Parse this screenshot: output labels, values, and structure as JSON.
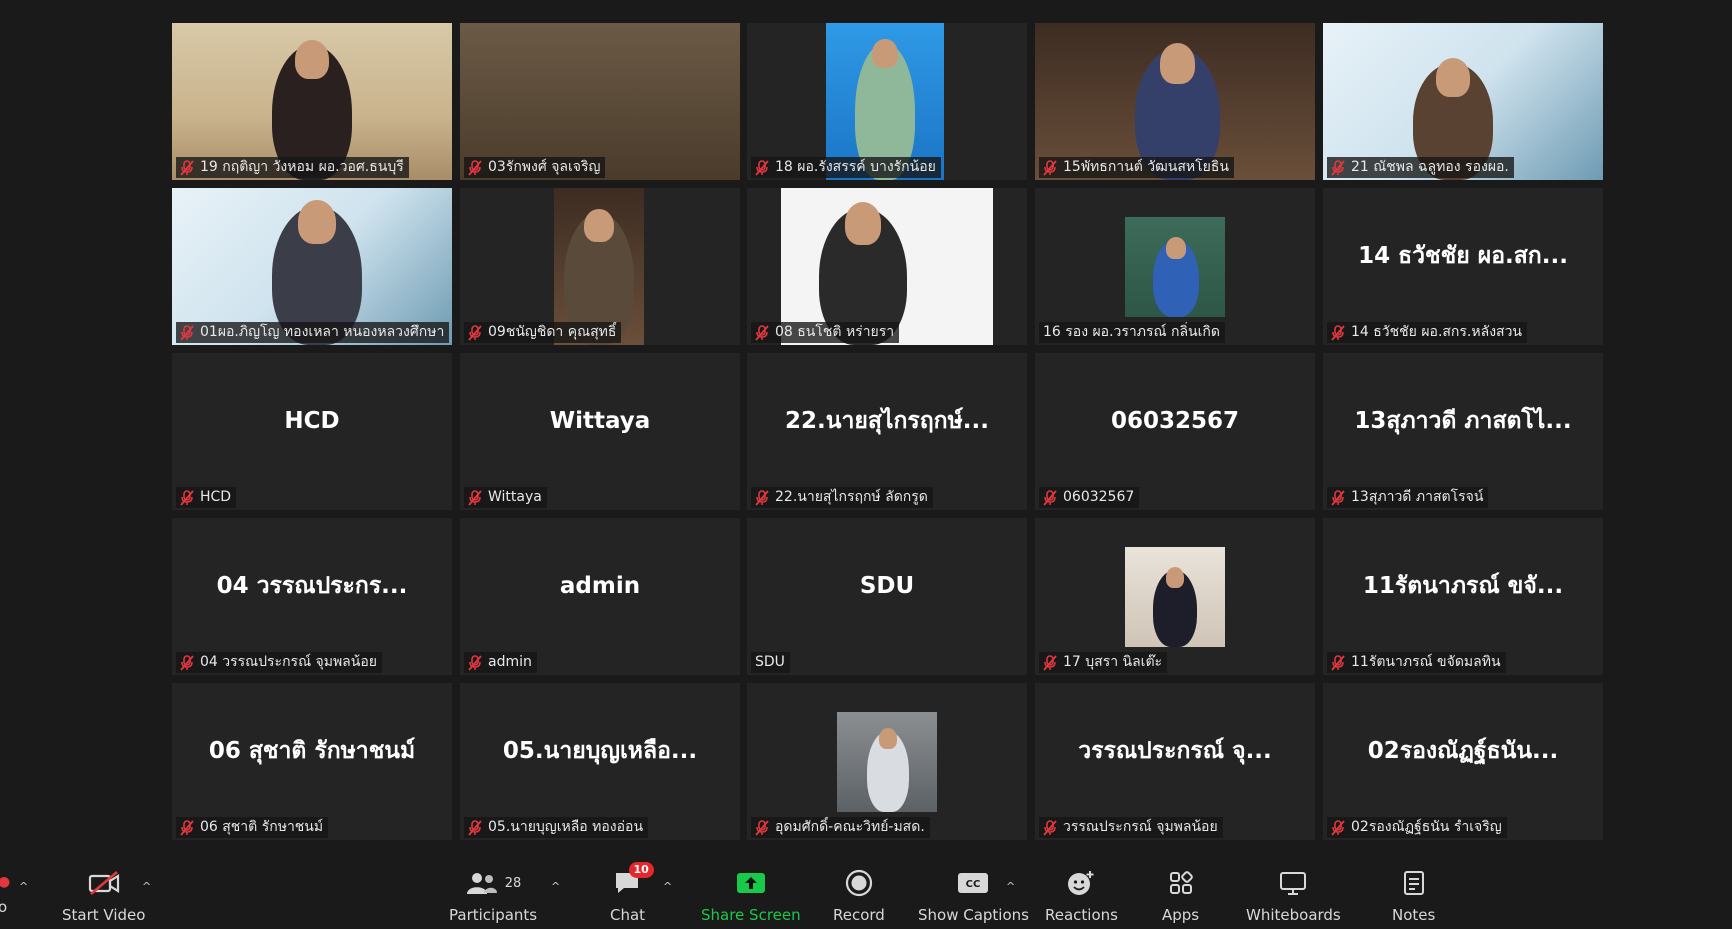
{
  "tiles": [
    {
      "label": "19 กฤติญา วังหอม ผอ.วอศ.ธนบุรี",
      "muted": true,
      "video": "wall"
    },
    {
      "label": "03รักพงศ์ จุลเจริญ",
      "muted": true,
      "video": "shelf"
    },
    {
      "label": "18 ผอ.รังสรรค์ บางรักน้อย",
      "muted": true,
      "video": "blue"
    },
    {
      "label": "15พัทธกานต์  วัฒนสหโยธิน",
      "muted": true,
      "video": "room"
    },
    {
      "label": "21 ณัชพล ฉลูทอง รองผอ.",
      "muted": true,
      "video": "slide"
    },
    {
      "label": "01ผอ.ภิญโญ  ทองเหลา หนองหลวงศึกษา",
      "muted": true,
      "video": "slide2"
    },
    {
      "label": "09ชนัญชิดา  คุณสุทธิ์",
      "muted": true,
      "video": "small-room"
    },
    {
      "label": "08 ธนโชติ  หร่ายรา",
      "muted": true,
      "video": "white"
    },
    {
      "label": "16 รอง ผอ.วราภรณ์ กลิ่นเกิด",
      "muted": false,
      "video": "board"
    },
    {
      "label": "14 ธวัชชัย ผอ.สกร.หลังสวน",
      "muted": true,
      "name": "14 ธวัชชัย ผอ.สก..."
    },
    {
      "label": "HCD",
      "muted": true,
      "name": "HCD"
    },
    {
      "label": "Wittaya",
      "muted": true,
      "name": "Wittaya"
    },
    {
      "label": "22.นายสุไกรฤกษ์ ลัดกรูด",
      "muted": true,
      "name": "22.นายสุไกรฤกษ์..."
    },
    {
      "label": "06032567",
      "muted": true,
      "name": "06032567"
    },
    {
      "label": "13สุภาวดี ภาสตโรจน์",
      "muted": true,
      "name": "13สุภาวดี ภาสตโไ..."
    },
    {
      "label": "04 วรรณประกรณ์  จุมพลน้อย",
      "muted": true,
      "name": "04 วรรณประกร..."
    },
    {
      "label": "admin",
      "muted": true,
      "name": "admin"
    },
    {
      "label": "SDU",
      "muted": false,
      "name": "SDU"
    },
    {
      "label": "17 บุสรา นิลเต๊ะ",
      "muted": true,
      "video": "office"
    },
    {
      "label": "11รัตนาภรณ์ ขจัดมลทิน",
      "muted": true,
      "name": "11รัตนาภรณ์ ขจั..."
    },
    {
      "label": "06 สุชาติ รักษาชนม์",
      "muted": true,
      "name": "06 สุชาติ รักษาชนม์"
    },
    {
      "label": "05.นายบุญเหลือ ทองอ่อน",
      "muted": true,
      "name": "05.นายบุญเหลือ..."
    },
    {
      "label": "อุดมศักดิ์-คณะวิทย์-มสด.",
      "muted": true,
      "video": "grey"
    },
    {
      "label": "วรรณประกรณ์ จุมพลน้อย",
      "muted": true,
      "name": "วรรณประกรณ์ จุ..."
    },
    {
      "label": "02รองณัฏฐ์ธนัน  รำเจริญ",
      "muted": true,
      "name": "02รองณัฏฐ์ธนัน..."
    }
  ],
  "toolbar": {
    "start_video": "Start Video",
    "participants": "Participants",
    "participants_count": "28",
    "chat": "Chat",
    "chat_badge": "10",
    "share_screen": "Share Screen",
    "record": "Record",
    "show_captions": "Show Captions",
    "reactions": "Reactions",
    "apps": "Apps",
    "whiteboards": "Whiteboards",
    "notes": "Notes"
  },
  "colors": {
    "share_screen_green": "#19c94a",
    "mute_red": "#e0383e",
    "badge_red": "#e5262a"
  }
}
